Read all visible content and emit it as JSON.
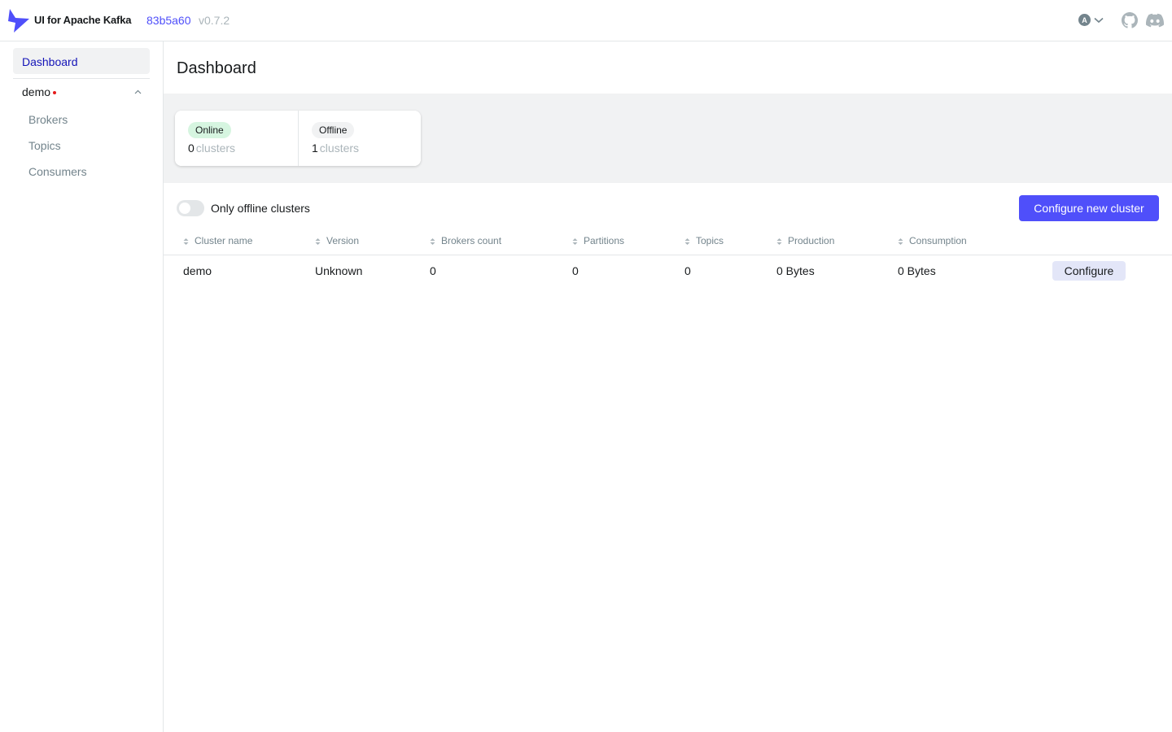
{
  "header": {
    "brand": "UI for Apache Kafka",
    "commit": "83b5a60",
    "version": "v0.7.2",
    "avatar_letter": "A",
    "icons": [
      "logo-icon",
      "avatar-icon",
      "chevron-down-icon",
      "github-icon",
      "discord-icon"
    ]
  },
  "sidebar": {
    "dashboard_label": "Dashboard",
    "cluster": {
      "name": "demo",
      "status_color": "#e51a1a",
      "items": [
        {
          "label": "Brokers"
        },
        {
          "label": "Topics"
        },
        {
          "label": "Consumers"
        }
      ]
    }
  },
  "main": {
    "title": "Dashboard",
    "metrics": [
      {
        "tag": "Online",
        "count": "0",
        "unit": "clusters",
        "tag_color": "#d6f5e0"
      },
      {
        "tag": "Offline",
        "count": "1",
        "unit": "clusters",
        "tag_color": "#f1f2f3"
      }
    ],
    "toggle_label": "Only offline clusters",
    "toggle_on": false,
    "configure_new_label": "Configure new cluster",
    "table": {
      "columns": [
        "Cluster name",
        "Version",
        "Brokers count",
        "Partitions",
        "Topics",
        "Production",
        "Consumption"
      ],
      "rows": [
        {
          "cluster_name": "demo",
          "version": "Unknown",
          "brokers_count": "0",
          "partitions": "0",
          "topics": "0",
          "production": "0 Bytes",
          "consumption": "0 Bytes",
          "action_label": "Configure"
        }
      ]
    }
  },
  "colors": {
    "accent": "#4f4ffa",
    "nav_active": "#1414b8"
  }
}
